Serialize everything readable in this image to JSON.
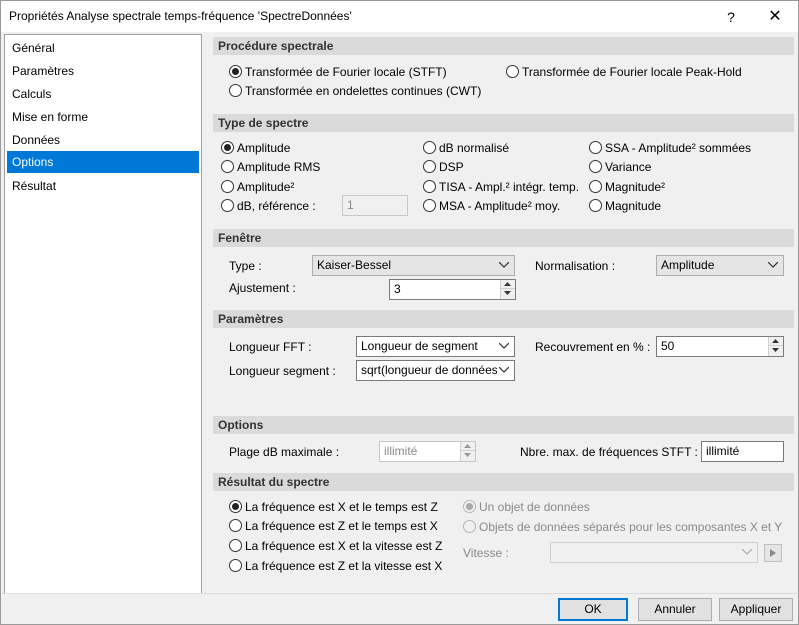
{
  "window": {
    "title": "Propriétés Analyse spectrale temps-fréquence 'SpectreDonnées'",
    "help": "?",
    "close": "✕"
  },
  "nav": {
    "items": [
      "Général",
      "Paramètres",
      "Calculs",
      "Mise en forme",
      "Données",
      "Options",
      "Résultat"
    ],
    "selected": "Options"
  },
  "procedure": {
    "title": "Procédure spectrale",
    "stft": "Transformée de Fourier locale (STFT)",
    "peak_hold": "Transformée de Fourier locale Peak-Hold",
    "cwt": "Transformée en ondelettes continues (CWT)",
    "selected": "stft"
  },
  "spectrum_type": {
    "title": "Type de spectre",
    "col1": [
      "Amplitude",
      "Amplitude RMS",
      "Amplitude²",
      "dB, référence :"
    ],
    "col2": [
      "dB normalisé",
      "DSP",
      "TISA - Ampl.² intégr. temp.",
      "MSA - Amplitude² moy."
    ],
    "col3": [
      "SSA - Amplitude² sommées",
      "Variance",
      "Magnitude²",
      "Magnitude"
    ],
    "selected": "Amplitude",
    "db_reference_value": "1"
  },
  "window_section": {
    "title": "Fenêtre",
    "type_label": "Type :",
    "type_value": "Kaiser-Bessel",
    "normalisation_label": "Normalisation :",
    "normalisation_value": "Amplitude",
    "adjust_label": "Ajustement :",
    "adjust_value": "3"
  },
  "parameters": {
    "title": "Paramètres",
    "fft_label": "Longueur FFT :",
    "fft_value": "Longueur de segment",
    "overlap_label": "Recouvrement en % :",
    "overlap_value": "50",
    "segment_label": "Longueur segment :",
    "segment_value": "sqrt(longueur de données) *"
  },
  "options": {
    "title": "Options",
    "db_range_label": "Plage dB maximale :",
    "db_range_value": "illimité",
    "max_freq_label": "Nbre. max. de fréquences STFT :",
    "max_freq_value": "illimité"
  },
  "result": {
    "title": "Résultat du spectre",
    "left": [
      "La fréquence est X et le temps est Z",
      "La fréquence est Z et le temps est X",
      "La fréquence est X et la vitesse est Z",
      "La fréquence est Z et la vitesse est X"
    ],
    "left_selected": 0,
    "single_object": "Un objet de données",
    "separate_objects": "Objets de données séparés pour les composantes X et Y",
    "speed_label": "Vitesse :",
    "speed_value": ""
  },
  "footer": {
    "ok": "OK",
    "cancel": "Annuler",
    "apply": "Appliquer"
  },
  "colors": {
    "accent": "#0078d7",
    "section_bg": "#dadada",
    "dialog_bg": "#f0f0f0"
  }
}
